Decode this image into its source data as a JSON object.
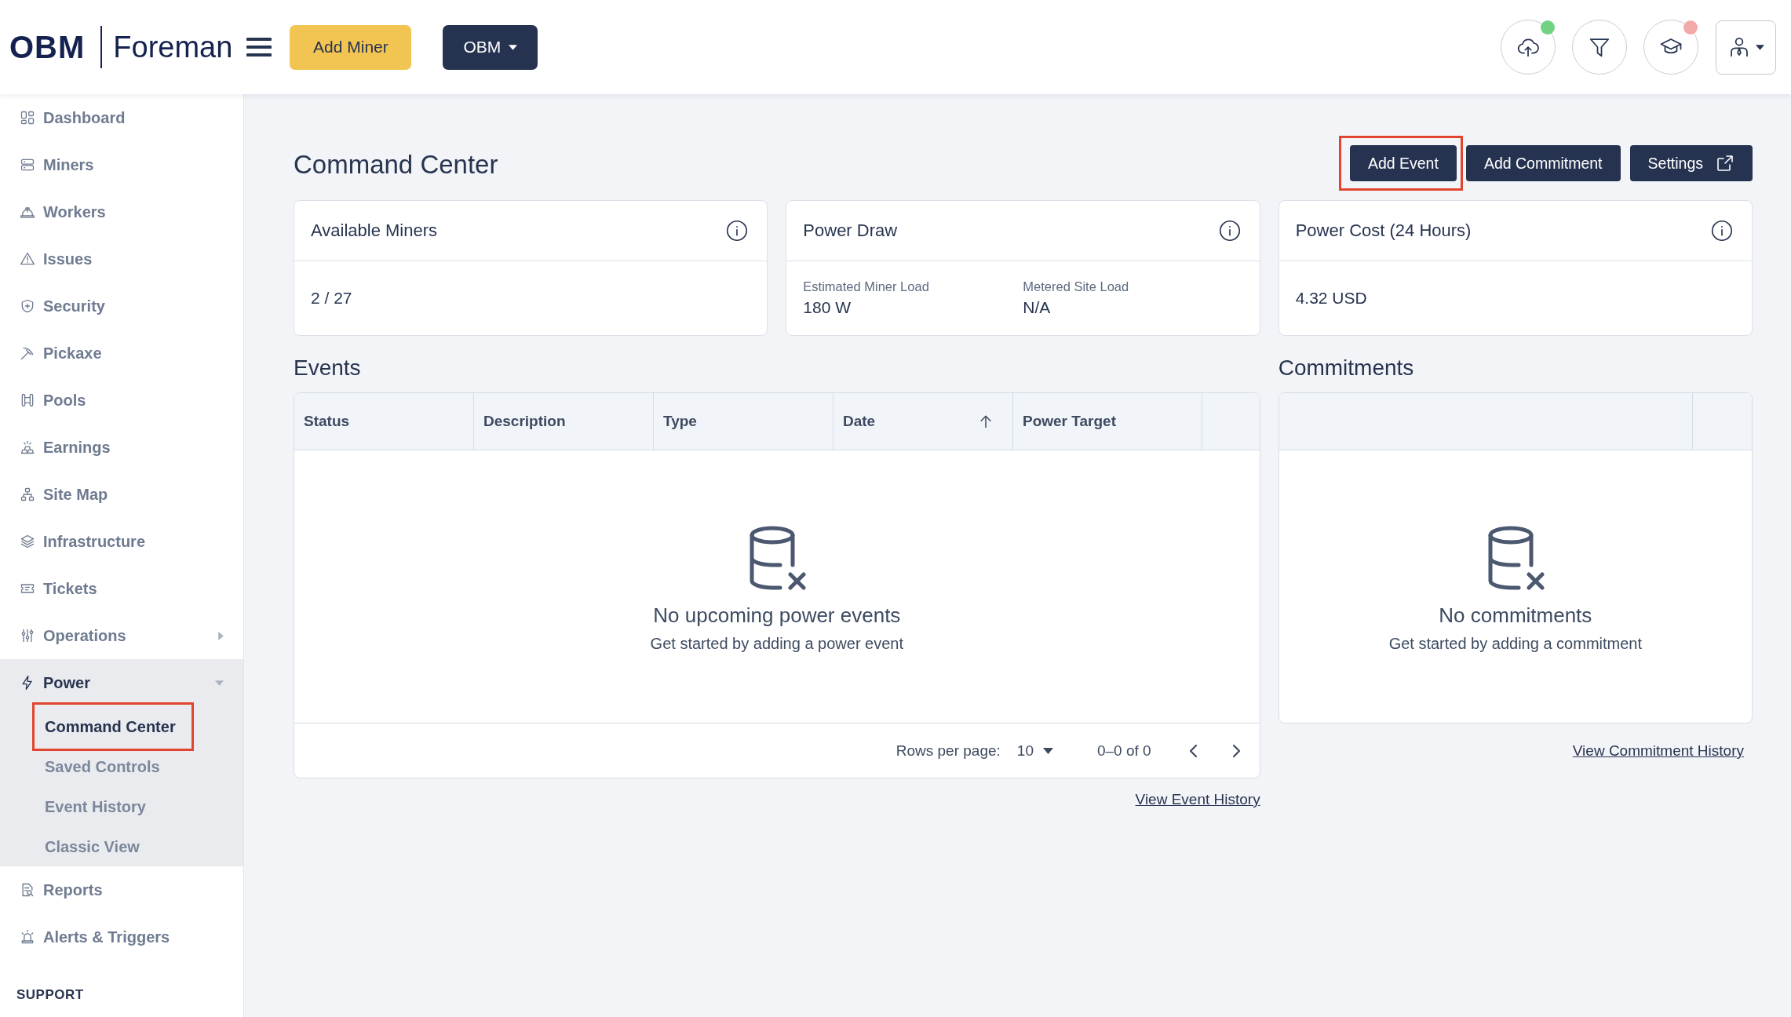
{
  "header": {
    "logo": {
      "brand": "OBM",
      "product": "Foreman"
    },
    "primary_button": "Add Miner",
    "org_dropdown": "OBM",
    "icon_buttons": [
      {
        "kind": "upload",
        "color": "#72d283"
      },
      {
        "kind": "filter"
      },
      {
        "kind": "academy",
        "color": "#f4a9a9"
      }
    ]
  },
  "sidebar": {
    "items": [
      {
        "label": "Dashboard",
        "kind": "dashboard",
        "selected": false
      },
      {
        "label": "Miners",
        "kind": "miners",
        "selected": false
      },
      {
        "label": "Workers",
        "kind": "workers",
        "selected": false
      },
      {
        "label": "Issues",
        "kind": "issues",
        "selected": false
      },
      {
        "label": "Security",
        "kind": "security",
        "selected": false
      },
      {
        "label": "Pickaxe",
        "kind": "pickaxe",
        "selected": false
      },
      {
        "label": "Pools",
        "kind": "pools",
        "selected": false
      },
      {
        "label": "Earnings",
        "kind": "earnings",
        "selected": false
      },
      {
        "label": "Site Map",
        "kind": "site_map",
        "selected": false
      },
      {
        "label": "Infrastructure",
        "kind": "infrastructure",
        "selected": false
      },
      {
        "label": "Tickets",
        "kind": "tickets",
        "selected": false
      },
      {
        "label": "Operations",
        "kind": "operations",
        "selected": false,
        "expanded": false
      },
      {
        "label": "Power",
        "kind": "power",
        "selected": true,
        "expanded": true,
        "children": [
          {
            "label": "Command Center",
            "selected": true,
            "highlighted": true
          },
          {
            "label": "Saved Controls",
            "selected": false,
            "highlighted": false
          },
          {
            "label": "Event History",
            "selected": false,
            "highlighted": false
          },
          {
            "label": "Classic View",
            "selected": false,
            "highlighted": false
          }
        ]
      },
      {
        "label": "Reports",
        "kind": "reports",
        "selected": false
      },
      {
        "label": "Alerts & Triggers",
        "kind": "alerts",
        "selected": false
      }
    ],
    "section_heading": "SUPPORT"
  },
  "page": {
    "title": "Command Center",
    "actions": [
      {
        "label": "Add Event",
        "kind": "plain",
        "highlighted": true
      },
      {
        "label": "Add Commitment",
        "kind": "plain",
        "highlighted": false
      },
      {
        "label": "Settings",
        "kind": "external",
        "highlighted": false
      }
    ]
  },
  "stat_cards": [
    {
      "title": "Available Miners",
      "kind": "single",
      "value": "2 / 27"
    },
    {
      "title": "Power Draw",
      "kind": "split",
      "metrics": [
        {
          "label": "Estimated Miner Load",
          "value": "180 W"
        },
        {
          "label": "Metered Site Load",
          "value": "N/A"
        }
      ]
    },
    {
      "title": "Power Cost (24 Hours)",
      "kind": "single",
      "value": "4.32 USD"
    }
  ],
  "events": {
    "title": "Events",
    "columns": [
      {
        "label": "Status",
        "sorted": false
      },
      {
        "label": "Description",
        "sorted": false
      },
      {
        "label": "Type",
        "sorted": false
      },
      {
        "label": "Date",
        "sorted": true
      },
      {
        "label": "Power Target",
        "sorted": false
      }
    ],
    "empty_state": {
      "title": "No upcoming power events",
      "subtitle": "Get started by adding a power event"
    },
    "pagination": {
      "rows_per_page_label": "Rows per page:",
      "rows_per_page": "10",
      "range": "0–0 of 0"
    },
    "history_link": "View Event History"
  },
  "commitments": {
    "title": "Commitments",
    "empty_state": {
      "title": "No commitments",
      "subtitle": "Get started by adding a commitment"
    },
    "history_link": "View Commitment History"
  }
}
